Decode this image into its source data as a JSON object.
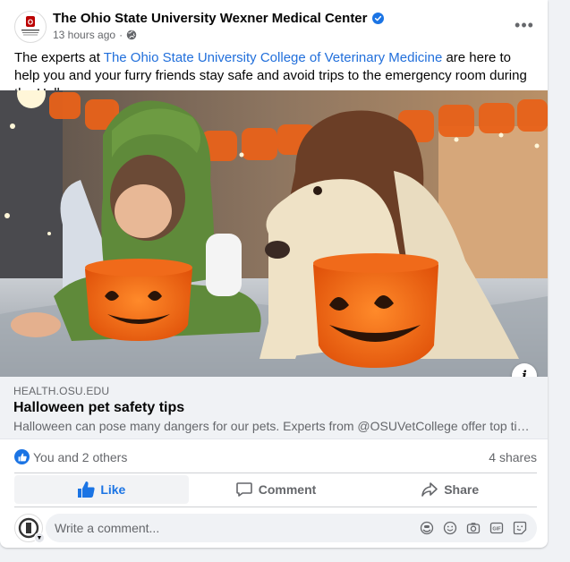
{
  "post": {
    "author": "The Ohio State University Wexner Medical Center",
    "time": "13 hours ago",
    "text_before_link": "The experts at ",
    "link_text": "The Ohio State University College of Veterinary Medicine",
    "text_after_link": " are here to help you and your furry friends stay safe and avoid trips to the emergency room during the Halloween season.",
    "avatar_text": "O",
    "avatar_caption": "THE OHIO STATE UNIVERSITY WEXNER MEDICAL CENTER"
  },
  "link_preview": {
    "domain": "HEALTH.OSU.EDU",
    "title": "Halloween pet safety tips",
    "description": "Halloween can pose many dangers for our pets. Experts from @OSUVetCollege offer top tips t..."
  },
  "stats": {
    "reactors": "You and 2 others",
    "shares": "4 shares"
  },
  "actions": {
    "like": "Like",
    "comment": "Comment",
    "share": "Share"
  },
  "comment": {
    "placeholder": "Write a comment..."
  },
  "colors": {
    "brand_blue": "#1b74e4",
    "link_blue": "#216fdb",
    "osu_scarlet": "#bb0000"
  }
}
